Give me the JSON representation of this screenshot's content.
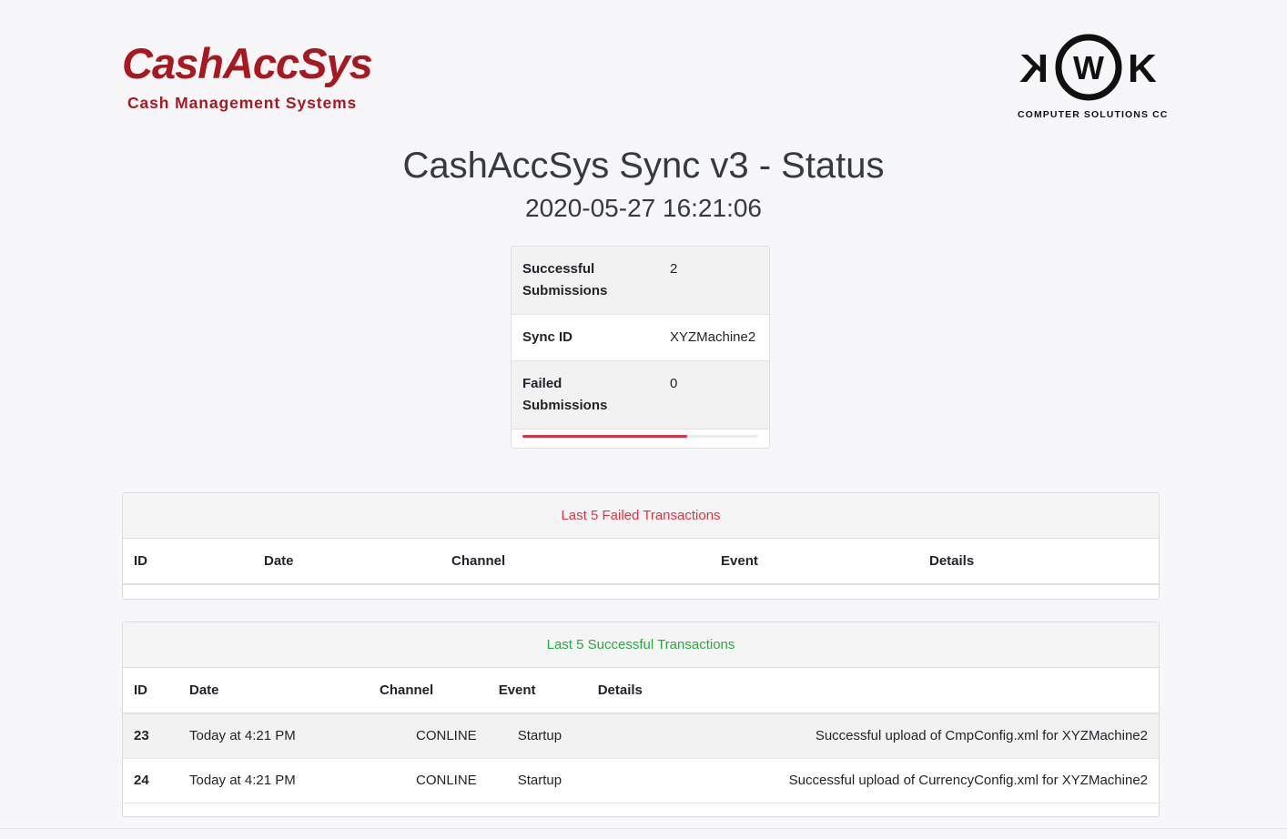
{
  "logos": {
    "left_brand": "CashAccSys",
    "left_tagline": "Cash Management Systems",
    "right_brand": "KWK",
    "right_tagline": "COMPUTER SOLUTIONS CC"
  },
  "page": {
    "title": "CashAccSys Sync v3 - Status",
    "timestamp": "2020-05-27 16:21:06"
  },
  "summary": {
    "rows": [
      {
        "label": "Successful Submissions",
        "value": "2"
      },
      {
        "label": "Sync ID",
        "value": "XYZMachine2"
      },
      {
        "label": "Failed Submissions",
        "value": "0"
      }
    ],
    "progress_fraction": 0.7,
    "progress_color": "#d9304a"
  },
  "failed": {
    "title": "Last 5 Failed Transactions",
    "color": "#dc3545",
    "columns": [
      "ID",
      "Date",
      "Channel",
      "Event",
      "Details"
    ]
  },
  "success": {
    "title": "Last 5 Successful Transactions",
    "color": "#28a745",
    "columns": [
      "ID",
      "Date",
      "Channel",
      "Event",
      "Details"
    ],
    "rows": [
      {
        "id": "23",
        "date": "Today at 4:21 PM",
        "channel": "CONLINE",
        "event": "Startup",
        "details": "Successful upload of CmpConfig.xml for XYZMachine2"
      },
      {
        "id": "24",
        "date": "Today at 4:21 PM",
        "channel": "CONLINE",
        "event": "Startup",
        "details": "Successful upload of CurrencyConfig.xml for XYZMachine2"
      }
    ]
  }
}
